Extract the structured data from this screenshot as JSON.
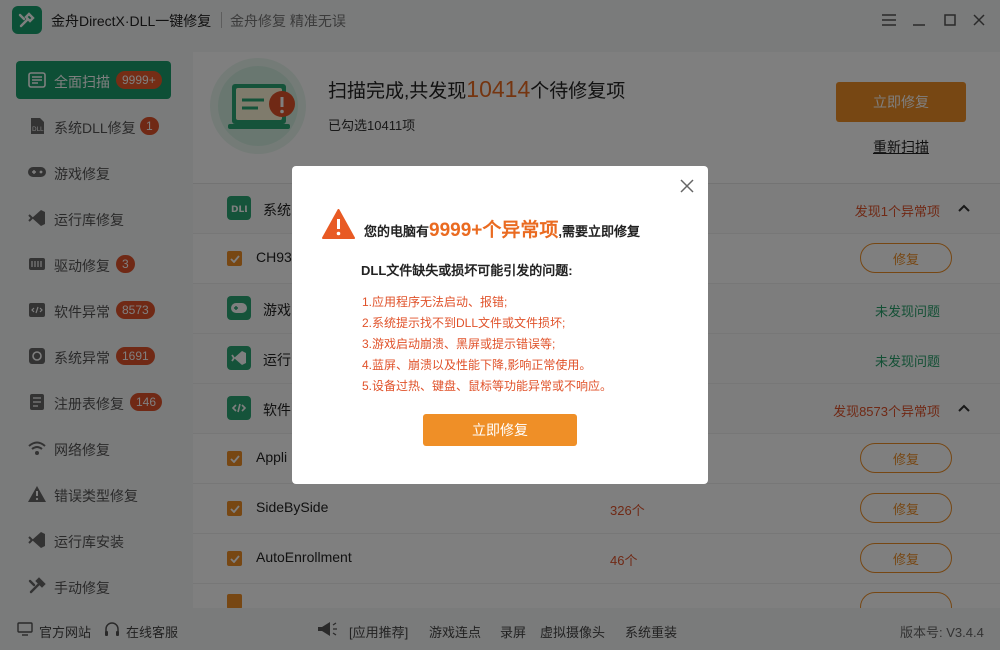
{
  "app": {
    "title": "金舟DirectX·DLL一键修复",
    "slogan": "金舟修复 精准无误"
  },
  "window_controls": [
    "menu-icon",
    "minimize-icon",
    "maximize-icon",
    "close-icon"
  ],
  "sidebar": {
    "items": [
      {
        "label": "全面扫描",
        "badge": "9999+",
        "icon": "scan-icon",
        "active": true
      },
      {
        "label": "系统DLL修复",
        "badge": "1",
        "icon": "dll-icon"
      },
      {
        "label": "游戏修复",
        "badge": "",
        "icon": "gamepad-icon"
      },
      {
        "label": "运行库修复",
        "badge": "",
        "icon": "runtime-icon"
      },
      {
        "label": "驱动修复",
        "badge": "3",
        "icon": "driver-icon"
      },
      {
        "label": "软件异常",
        "badge": "8573",
        "icon": "software-icon"
      },
      {
        "label": "系统异常",
        "badge": "1691",
        "icon": "gear-icon"
      },
      {
        "label": "注册表修复",
        "badge": "146",
        "icon": "registry-icon"
      },
      {
        "label": "网络修复",
        "badge": "",
        "icon": "wifi-icon"
      },
      {
        "label": "错误类型修复",
        "badge": "",
        "icon": "warning-icon"
      },
      {
        "label": "运行库安装",
        "badge": "",
        "icon": "install-icon"
      },
      {
        "label": "手动修复",
        "badge": "",
        "icon": "tools-icon"
      }
    ]
  },
  "scan": {
    "title_prefix": "扫描完成,共发现",
    "count": "10414",
    "title_suffix": "个待修复项",
    "selected": "已勾选10411项",
    "fix_button": "立即修复",
    "rescan": "重新扫描"
  },
  "rows": [
    {
      "type": "cat",
      "name": "系统",
      "status": "发现1个异常项",
      "status_type": "warn",
      "icon": "dll-icon",
      "expanded": true
    },
    {
      "type": "item",
      "name": "CH93",
      "count": "",
      "button": "修复"
    },
    {
      "type": "cat",
      "name": "游戏",
      "status": "未发现问题",
      "status_type": "ok",
      "icon": "gamepad-icon"
    },
    {
      "type": "cat",
      "name": "运行",
      "status": "未发现问题",
      "status_type": "ok",
      "icon": "runtime-icon"
    },
    {
      "type": "cat",
      "name": "软件",
      "status": "发现8573个异常项",
      "status_type": "warn",
      "icon": "software-icon",
      "expanded": true
    },
    {
      "type": "item",
      "name": "Appli",
      "count": "",
      "button": "修复"
    },
    {
      "type": "item",
      "name": "SideBySide",
      "count": "326个",
      "button": "修复"
    },
    {
      "type": "item",
      "name": "AutoEnrollment",
      "count": "46个",
      "button": "修复"
    }
  ],
  "footer": {
    "official_site": "官方网站",
    "online_service": "在线客服",
    "recommend": "[应用推荐]",
    "links": [
      "游戏连点",
      "录屏",
      "虚拟摄像头",
      "系统重装"
    ],
    "version": "版本号: V3.4.4"
  },
  "modal": {
    "head_prefix": "您的电脑有",
    "head_count": "9999+个异常项",
    "head_suffix": ",需要立即修复",
    "subtitle": "DLL文件缺失或损坏可能引发的问题:",
    "problems": [
      "1.应用程序无法启动、报错;",
      "2.系统提示找不到DLL文件或文件损坏;",
      "3.游戏启动崩溃、黑屏或提示错误等;",
      "4.蓝屏、崩溃以及性能下降,影响正常使用。",
      "5.设备过热、键盘、鼠标等功能异常或不响应。"
    ],
    "button": "立即修复"
  },
  "colors": {
    "brand_green": "#1b9e6c",
    "accent_orange": "#ef8f27",
    "warn_red": "#e0522a",
    "ok_green": "#27a06b"
  }
}
